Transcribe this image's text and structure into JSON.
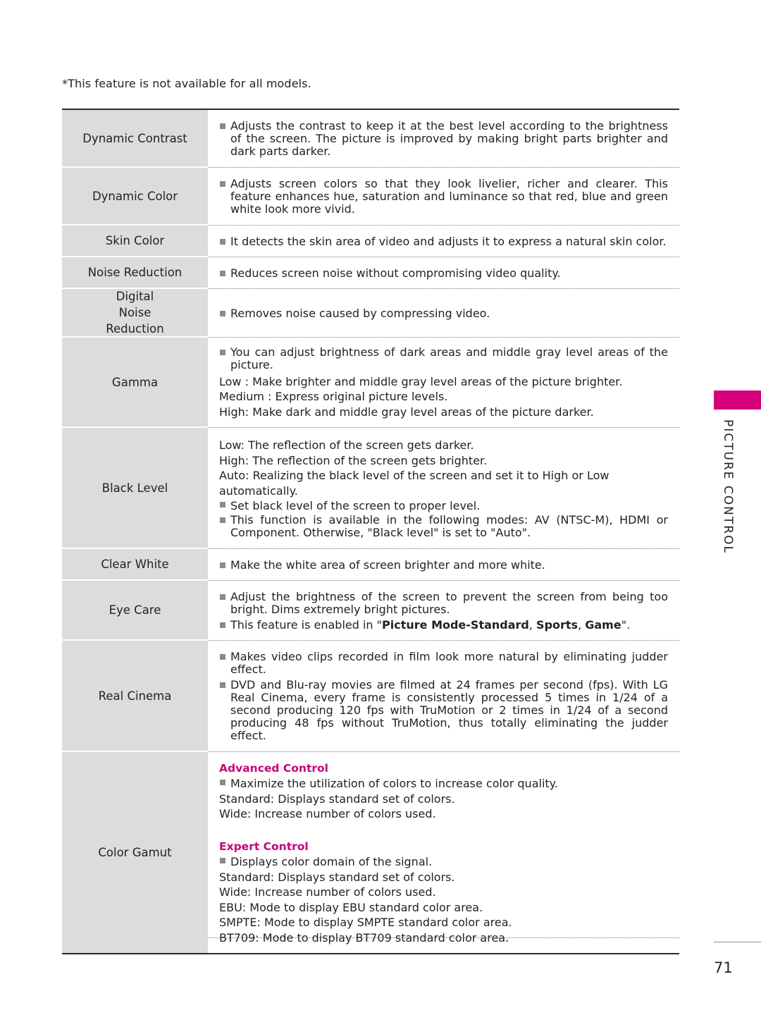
{
  "note": "*This feature is not available for all models.",
  "side_tab": {
    "label": "PICTURE CONTROL",
    "accent_color": "#d4007c"
  },
  "page_number": "71",
  "rows": [
    {
      "label": "Dynamic Contrast",
      "lines": [
        {
          "type": "bullet",
          "text": "Adjusts the contrast to keep it at the best level according to the brightness of the screen. The picture is improved by making bright parts brighter and dark parts darker."
        }
      ]
    },
    {
      "label": "Dynamic Color",
      "lines": [
        {
          "type": "bullet",
          "text": "Adjusts screen colors so that they look livelier, richer and clearer. This feature enhances hue, saturation and luminance so that red, blue and green white look more vivid."
        }
      ]
    },
    {
      "label": "Skin Color",
      "lines": [
        {
          "type": "bullet",
          "text": "It detects the skin area of video and adjusts it to express a natural skin color."
        }
      ]
    },
    {
      "label": "Noise Reduction",
      "lines": [
        {
          "type": "bullet",
          "text": "Reduces screen noise without compromising video quality."
        }
      ]
    },
    {
      "label": "Digital Noise Reduction",
      "lines": [
        {
          "type": "bullet",
          "text": "Removes noise caused by compressing video."
        }
      ]
    },
    {
      "label": "Gamma",
      "lines": [
        {
          "type": "bullet",
          "text": "You can adjust brightness of dark areas and middle gray level areas of the picture."
        },
        {
          "type": "plain",
          "text": "Low : Make brighter and middle gray level areas of the picture brighter."
        },
        {
          "type": "plain",
          "text": "Medium : Express original picture levels."
        },
        {
          "type": "plain",
          "text": "High: Make dark and middle gray level areas of the picture darker."
        }
      ]
    },
    {
      "label": "Black Level",
      "lines": [
        {
          "type": "plain",
          "text": "Low: The reflection of the screen gets darker."
        },
        {
          "type": "plain",
          "text": "High: The reflection of the screen gets brighter."
        },
        {
          "type": "plain",
          "text": "Auto: Realizing the black level of the screen and set it to High or Low automatically."
        },
        {
          "type": "bullet",
          "text": "Set black level of the screen to proper level."
        },
        {
          "type": "bullet",
          "text": "This function is available in the following modes: AV (NTSC-M), HDMI or Component. Otherwise, \"Black level\" is set to \"Auto\"."
        }
      ]
    },
    {
      "label": "Clear White",
      "lines": [
        {
          "type": "bullet",
          "text": "Make the white area of screen brighter and more white."
        }
      ]
    },
    {
      "label": "Eye Care",
      "lines": [
        {
          "type": "bullet",
          "text": "Adjust the brightness of the screen to prevent the screen from being too bright. Dims extremely bright pictures."
        },
        {
          "type": "bullet-rich",
          "prefix": "This feature is enabled in \"",
          "bold1": "Picture Mode-Standard",
          "sep1": ", ",
          "bold2": "Sports",
          "sep2": ", ",
          "bold3": "Game",
          "suffix": "\"."
        }
      ]
    },
    {
      "label": "Real Cinema",
      "lines": [
        {
          "type": "bullet",
          "text": "Makes video clips recorded in film look more natural by eliminating judder effect."
        },
        {
          "type": "bullet",
          "text": "DVD and Blu-ray movies are filmed at 24 frames per second (fps). With LG Real Cinema, every frame is consistently processed 5 times in 1/24 of a second producing 120 fps with TruMotion or 2 times in 1/24 of a second producing 48 fps without TruMotion, thus totally eliminating the judder effect."
        }
      ]
    },
    {
      "label": "Color Gamut",
      "sections": [
        {
          "heading": "Advanced Control",
          "lines": [
            {
              "type": "bullet",
              "text": " Maximize the utilization of colors to increase color quality."
            },
            {
              "type": "plain",
              "text": "Standard: Displays standard set of colors."
            },
            {
              "type": "plain",
              "text": "Wide: Increase number of colors used."
            }
          ]
        },
        {
          "heading": "Expert Control",
          "lines": [
            {
              "type": "bullet",
              "text": "Displays color domain of the signal."
            },
            {
              "type": "plain",
              "text": "Standard: Displays standard set of colors."
            },
            {
              "type": "plain",
              "text": "Wide: Increase number of colors used."
            },
            {
              "type": "plain",
              "text": "EBU: Mode to display EBU standard color area."
            },
            {
              "type": "plain",
              "text": "SMPTE: Mode to display SMPTE standard color area."
            },
            {
              "type": "plain",
              "text": "BT709: Mode to display BT709 standard color area."
            }
          ]
        }
      ]
    }
  ]
}
